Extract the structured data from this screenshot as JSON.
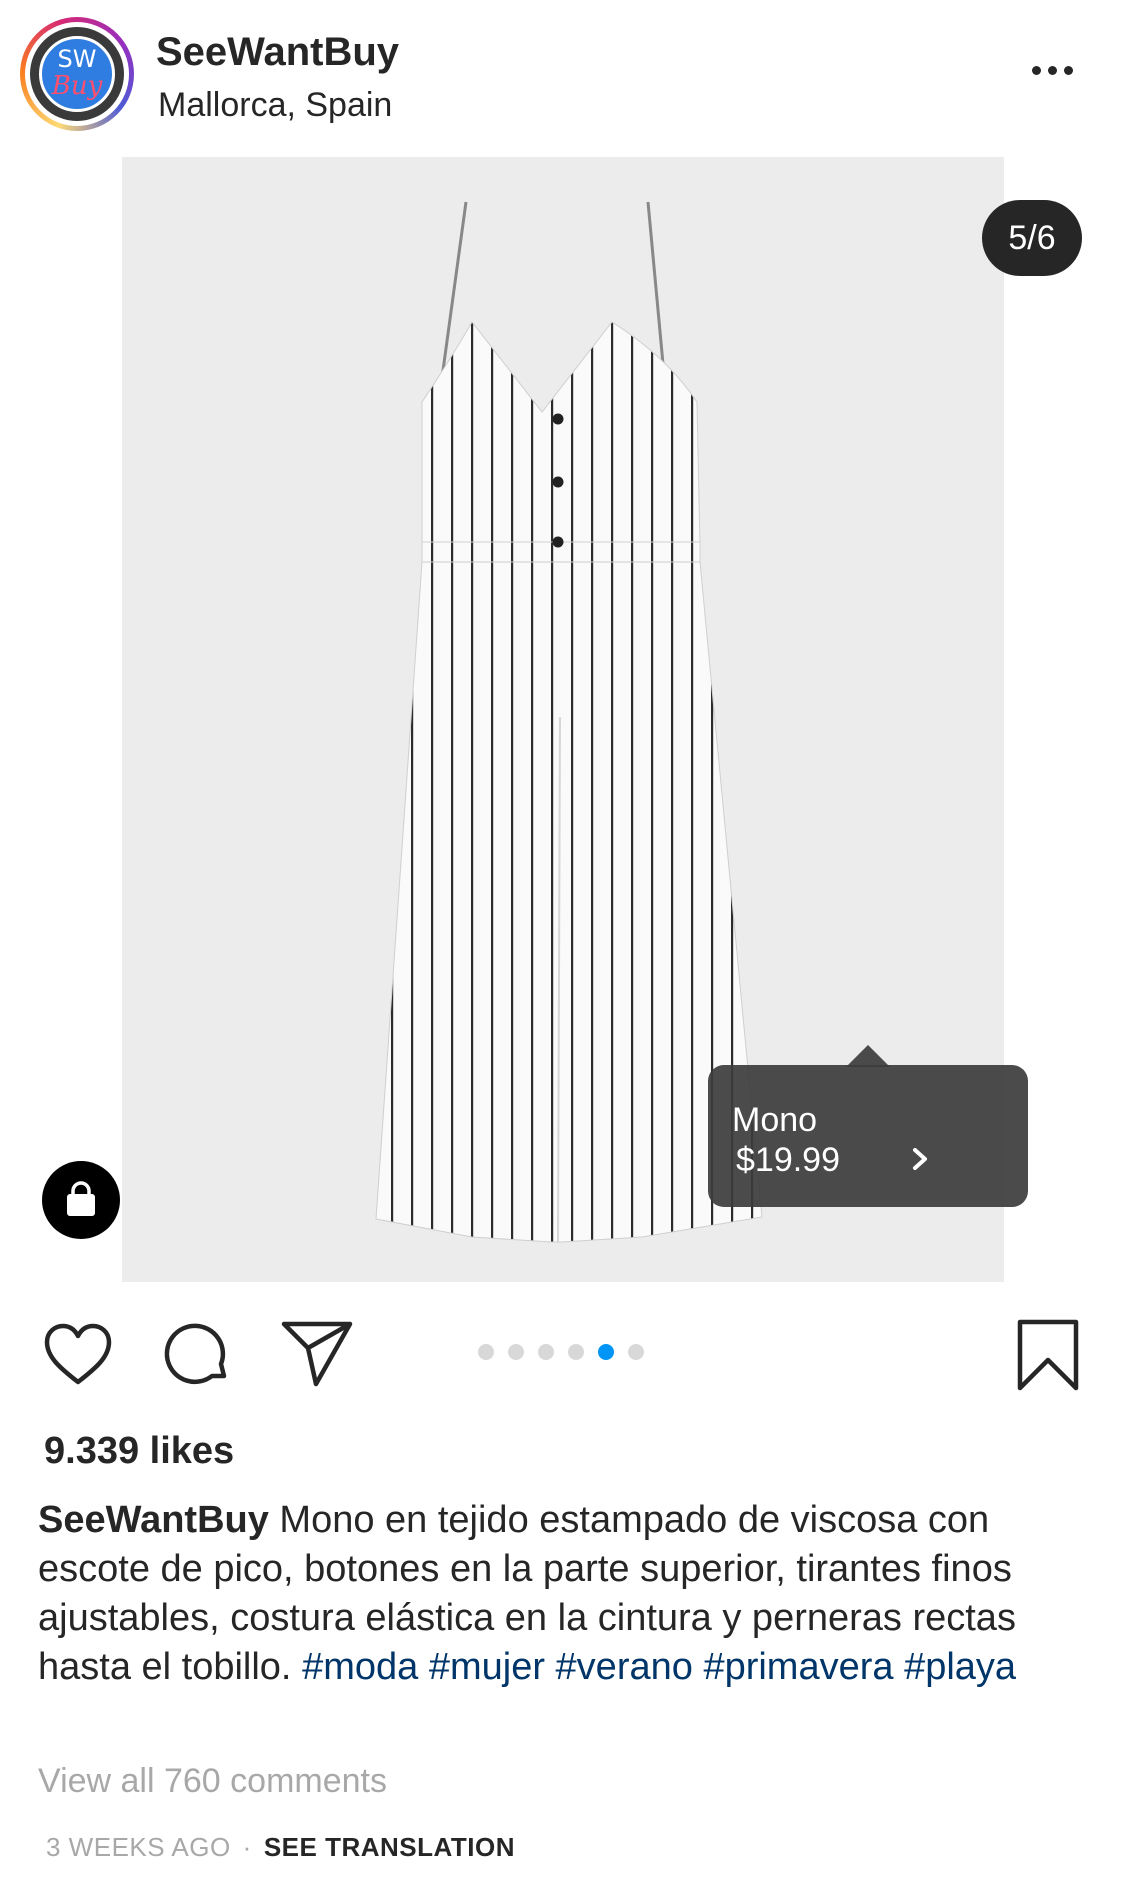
{
  "post": {
    "username": "SeeWantBuy",
    "location": "Mallorca, Spain",
    "avatar": {
      "line1": "SW",
      "line2": "Buy"
    },
    "carousel": {
      "counter": "5/6",
      "total": 6,
      "active_index": 4
    },
    "product_tag": {
      "name": "Mono",
      "price": "$19.99"
    },
    "likes": "9.339 likes",
    "caption": {
      "username": "SeeWantBuy",
      "text": " Mono en tejido estampado de viscosa con escote de pico, botones en la parte superior, tirantes finos ajustables, costura elástica en la cintura y perneras rectas hasta el tobillo. ",
      "hashtags": [
        "#moda",
        "#mujer",
        "#verano",
        "#primavera",
        "#playa"
      ]
    },
    "view_comments": "View all 760 comments",
    "time_ago": "3 WEEKS AGO",
    "separator": "·",
    "see_translation": "SEE TRANSLATION"
  },
  "icons": {
    "more": "more-horizontal-icon",
    "like": "heart-icon",
    "comment": "comment-bubble-icon",
    "share": "paper-plane-icon",
    "save": "bookmark-icon",
    "shop": "shopping-bag-icon"
  },
  "colors": {
    "hashtag": "#003569",
    "active_dot": "#0095f6",
    "inactive_dot": "#d8d8d8",
    "tag_bg": "#3c3c3c"
  }
}
